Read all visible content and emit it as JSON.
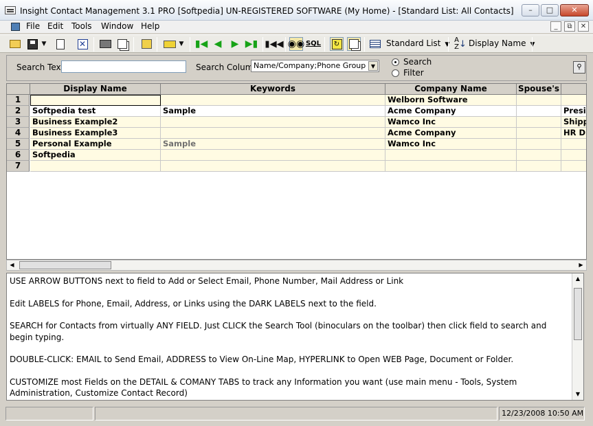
{
  "window": {
    "title": "Insight Contact Management 3.1 PRO [Softpedia] UN-REGISTERED SOFTWARE (My Home) - [Standard List: All Contacts]"
  },
  "menu": [
    "File",
    "Edit",
    "Tools",
    "Window",
    "Help"
  ],
  "toolbar": {
    "view": "Standard List",
    "sort": "Display Name",
    "sql": "SQL"
  },
  "search": {
    "text_label": "Search Text:",
    "text_value": "",
    "column_label": "Search Column:",
    "column_value": "Name/Company;Phone Group",
    "mode_search": "Search",
    "mode_filter": "Filter"
  },
  "grid": {
    "columns": [
      "Display Name",
      "Keywords",
      "Company Name",
      "Spouse's",
      ""
    ],
    "rows": [
      {
        "n": "1",
        "name": "",
        "kw": "",
        "company": "Welborn Software",
        "spouse": "",
        "extra": ""
      },
      {
        "n": "2",
        "name": "Softpedia test",
        "kw": "Sample",
        "company": "Acme Company",
        "spouse": "",
        "extra": "Presid"
      },
      {
        "n": "3",
        "name": "Business Example2",
        "kw": "",
        "company": "Wamco Inc",
        "spouse": "",
        "extra": "Shipp"
      },
      {
        "n": "4",
        "name": "Business Example3",
        "kw": "",
        "company": "Acme Company",
        "spouse": "",
        "extra": "HR Di"
      },
      {
        "n": "5",
        "name": "Personal Example",
        "kw": "Sample",
        "company": "Wamco Inc",
        "spouse": "",
        "extra": ""
      },
      {
        "n": "6",
        "name": "Softpedia",
        "kw": "",
        "company": "",
        "spouse": "",
        "extra": ""
      },
      {
        "n": "7",
        "name": "",
        "kw": "",
        "company": "",
        "spouse": "",
        "extra": ""
      }
    ]
  },
  "notes": [
    "USE ARROW BUTTONS next to field to Add or Select Email, Phone Number, Mail Address or Link",
    "Edit LABELS for Phone, Email, Address,  or Links using the DARK LABELS next to the field.",
    "SEARCH for Contacts from virtually ANY FIELD.  Just CLICK the Search Tool (binoculars on the toolbar) then click field to search and begin typing.",
    "DOUBLE-CLICK: EMAIL to Send Email,  ADDRESS to View On-Line Map, HYPERLINK to Open WEB Page, Document or Folder.",
    "CUSTOMIZE most Fields on the DETAIL & COMANY TABS to track any Information you want (use main menu - Tools, System Administration, Customize Contact Record)"
  ],
  "status": {
    "datetime": "12/23/2008 10:50 AM"
  },
  "colors": {
    "row_band": "#fffbe3",
    "toolbar_green": "#17a317"
  }
}
